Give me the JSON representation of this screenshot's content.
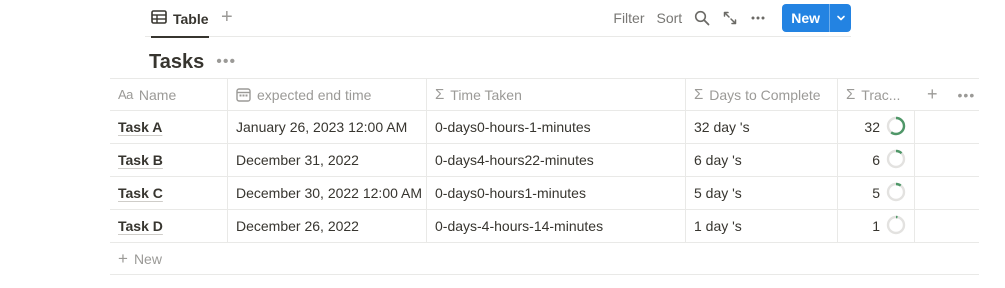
{
  "view": {
    "tab_label": "Table",
    "add_view": "+"
  },
  "toolbar": {
    "filter": "Filter",
    "sort": "Sort",
    "new_label": "New",
    "accent": "#2383e2"
  },
  "database": {
    "title": "Tasks",
    "more": "•••"
  },
  "columns": [
    {
      "label": "Name",
      "icon": "Aa"
    },
    {
      "label": "expected end time",
      "icon": "calendar-icon"
    },
    {
      "label": "Time Taken",
      "icon": "Σ"
    },
    {
      "label": "Days to Complete",
      "icon": "Σ"
    },
    {
      "label": "Trac...",
      "icon": "Σ"
    }
  ],
  "header_actions": {
    "add": "+",
    "more": "•••"
  },
  "rows": [
    {
      "name": "Task A",
      "end": "January 26, 2023 12:00 AM",
      "time": "0-days0-hours-1-minutes",
      "days": "32 day 's",
      "tracker": "32",
      "progress": 0.6
    },
    {
      "name": "Task B",
      "end": "December 31, 2022",
      "time": "0-days4-hours22-minutes",
      "days": "6 day 's",
      "tracker": "6",
      "progress": 0.12
    },
    {
      "name": "Task C",
      "end": "December 30, 2022 12:00 AM",
      "time": "0-days0-hours1-minutes",
      "days": "5 day 's",
      "tracker": "5",
      "progress": 0.1
    },
    {
      "name": "Task D",
      "end": "December 26, 2022",
      "time": "0-days-4-hours-14-minutes",
      "days": "1 day 's",
      "tracker": "1",
      "progress": 0.03
    }
  ],
  "footer": {
    "new_plus": "+",
    "new_label": "New"
  },
  "colors": {
    "progress": "#4f9768",
    "progress_track": "#e3e2e0"
  }
}
